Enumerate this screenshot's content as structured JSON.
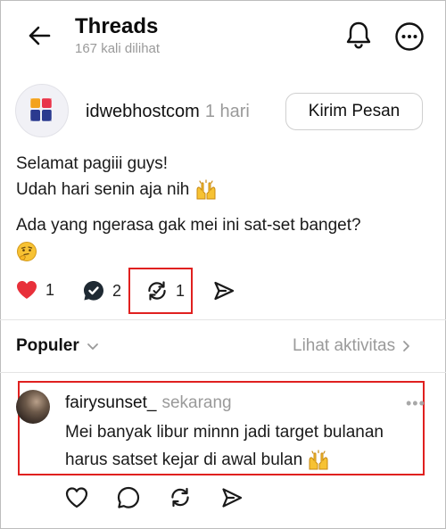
{
  "header": {
    "title": "Threads",
    "subtitle": "167 kali dilihat"
  },
  "post": {
    "author": "idwebhostcom",
    "time": "1 hari",
    "message_button": "Kirim Pesan",
    "lines": [
      "Selamat pagiii guys!",
      "Udah hari senin aja nih",
      "Ada yang ngerasa gak mei ini sat-set banget?"
    ],
    "actions": {
      "likes": "1",
      "replies": "2",
      "reposts": "1"
    }
  },
  "section": {
    "sort_label": "Populer",
    "activity_link": "Lihat aktivitas"
  },
  "comment": {
    "author": "fairysunset_",
    "time": "sekarang",
    "lines": [
      "Mei banyak libur minnn jadi target bulanan",
      "harus satset kejar di awal bulan"
    ]
  },
  "icons": {
    "back": "arrow-left-icon",
    "notifications": "bell-icon",
    "more": "more-icon",
    "like": "heart-icon",
    "reply": "comment-icon",
    "repost": "repost-icon",
    "share": "send-icon"
  },
  "colors": {
    "like_red": "#e8303a",
    "highlight_red": "#e0201f",
    "muted_text": "#9a9a9a"
  }
}
